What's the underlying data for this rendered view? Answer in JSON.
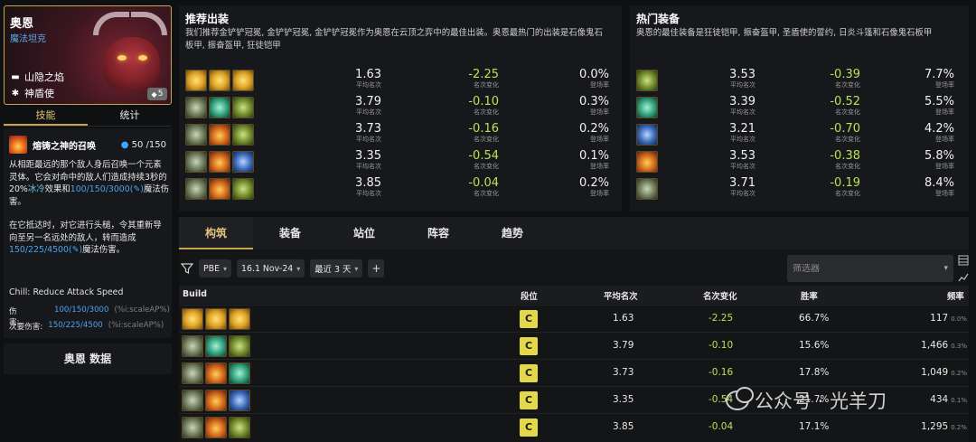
{
  "champion": {
    "name": "奥恩",
    "role": "魔法坦克",
    "traits": [
      "山隐之焰",
      "神盾使"
    ],
    "cost": "5",
    "tabs": [
      "技能",
      "统计"
    ]
  },
  "skill": {
    "name": "熔铸之神的召唤",
    "mana": "50 /150",
    "desc_1": "从相距最远的那个敌人身后召唤一个元素灵体。它会对命中的敌人们造成持续3秒的20%",
    "desc_ice": "冰冷",
    "desc_2": "效果和",
    "desc_val1": "100/150/3000",
    "desc_3": "魔法伤害。",
    "desc_4": "在它抵达时，对它进行头槌，令其重新导向至另一名远处的敌人，转而造成",
    "desc_val2": "150/225/4500",
    "desc_5": "魔法伤害。",
    "chill": "Chill: Reduce Attack Speed",
    "damage_label": "伤害:",
    "damage_value": "100/150/3000",
    "damage_scale": "(%i:scaleAP%)",
    "secondary_label": "次要伤害:",
    "secondary_value": "150/225/4500",
    "secondary_scale": "(%i:scaleAP%)"
  },
  "data_button": "奥恩 数据",
  "recommended": {
    "title": "推荐出装",
    "desc_line1": "我们推荐金铲铲冠冕, 金铲铲冠冕, 金铲铲冠冕作为奥恩在云顶之弈中的最佳出装。奥恩最热门的出装是石像鬼石",
    "desc_line2": "板甲, 振奋盔甲, 狂徒铠甲",
    "label_avg": "平均名次",
    "label_change": "名次变化",
    "label_rate": "登场率",
    "rows": [
      {
        "items": [
          "sp",
          "sp",
          "sp"
        ],
        "avg": "1.63",
        "change": "-2.25",
        "rate": "0.0%"
      },
      {
        "items": [
          "sg",
          "tt",
          "gr"
        ],
        "avg": "3.79",
        "change": "-0.10",
        "rate": "0.3%"
      },
      {
        "items": [
          "sg",
          "fi",
          "gr"
        ],
        "avg": "3.73",
        "change": "-0.16",
        "rate": "0.2%"
      },
      {
        "items": [
          "sg",
          "fi",
          "bl"
        ],
        "avg": "3.35",
        "change": "-0.54",
        "rate": "0.1%"
      },
      {
        "items": [
          "sg",
          "fi",
          "gr"
        ],
        "avg": "3.85",
        "change": "-0.04",
        "rate": "0.2%"
      }
    ]
  },
  "hot": {
    "title": "热门装备",
    "desc": "奥恩的最佳装备是狂徒铠甲, 振奋盔甲, 圣盾使的誓约, 日炎斗篷和石像鬼石板甲",
    "label_avg": "平均名次",
    "label_change": "名次变化",
    "label_rate": "登场率",
    "rows": [
      {
        "item": "gr",
        "avg": "3.53",
        "change": "-0.39",
        "rate": "7.7%"
      },
      {
        "item": "tt",
        "avg": "3.39",
        "change": "-0.52",
        "rate": "5.5%"
      },
      {
        "item": "bl",
        "avg": "3.21",
        "change": "-0.70",
        "rate": "4.2%"
      },
      {
        "item": "fi",
        "avg": "3.53",
        "change": "-0.38",
        "rate": "5.8%"
      },
      {
        "item": "sg",
        "avg": "3.71",
        "change": "-0.19",
        "rate": "8.4%"
      }
    ]
  },
  "tabs": [
    "构筑",
    "装备",
    "站位",
    "阵容",
    "趋势"
  ],
  "filters": {
    "mode": "PBE",
    "patch": "16.1 Nov-24",
    "range": "最近 3 天",
    "plus": "+",
    "selector_placeholder": "筛选器"
  },
  "table": {
    "headers": {
      "build": "Build",
      "tier": "段位",
      "avg": "平均名次",
      "change": "名次变化",
      "win": "胜率",
      "freq": "频率"
    },
    "rows": [
      {
        "items": [
          "sp",
          "sp",
          "sp"
        ],
        "tier": "C",
        "avg": "1.63",
        "change": "-2.25",
        "win": "66.7%",
        "count": "117",
        "pct": "0.0%"
      },
      {
        "items": [
          "sg",
          "tt",
          "gr"
        ],
        "tier": "C",
        "avg": "3.79",
        "change": "-0.10",
        "win": "15.6%",
        "count": "1,466",
        "pct": "0.3%"
      },
      {
        "items": [
          "sg",
          "fi",
          "tt"
        ],
        "tier": "C",
        "avg": "3.73",
        "change": "-0.16",
        "win": "17.8%",
        "count": "1,049",
        "pct": "0.2%"
      },
      {
        "items": [
          "sg",
          "fi",
          "bl"
        ],
        "tier": "C",
        "avg": "3.35",
        "change": "-0.54",
        "win": "21.7%",
        "count": "434",
        "pct": "0.1%"
      },
      {
        "items": [
          "sg",
          "fi",
          "gr"
        ],
        "tier": "C",
        "avg": "3.85",
        "change": "-0.04",
        "win": "17.1%",
        "count": "1,295",
        "pct": "0.2%"
      }
    ]
  },
  "watermark": "公众号 · 光羊刀"
}
